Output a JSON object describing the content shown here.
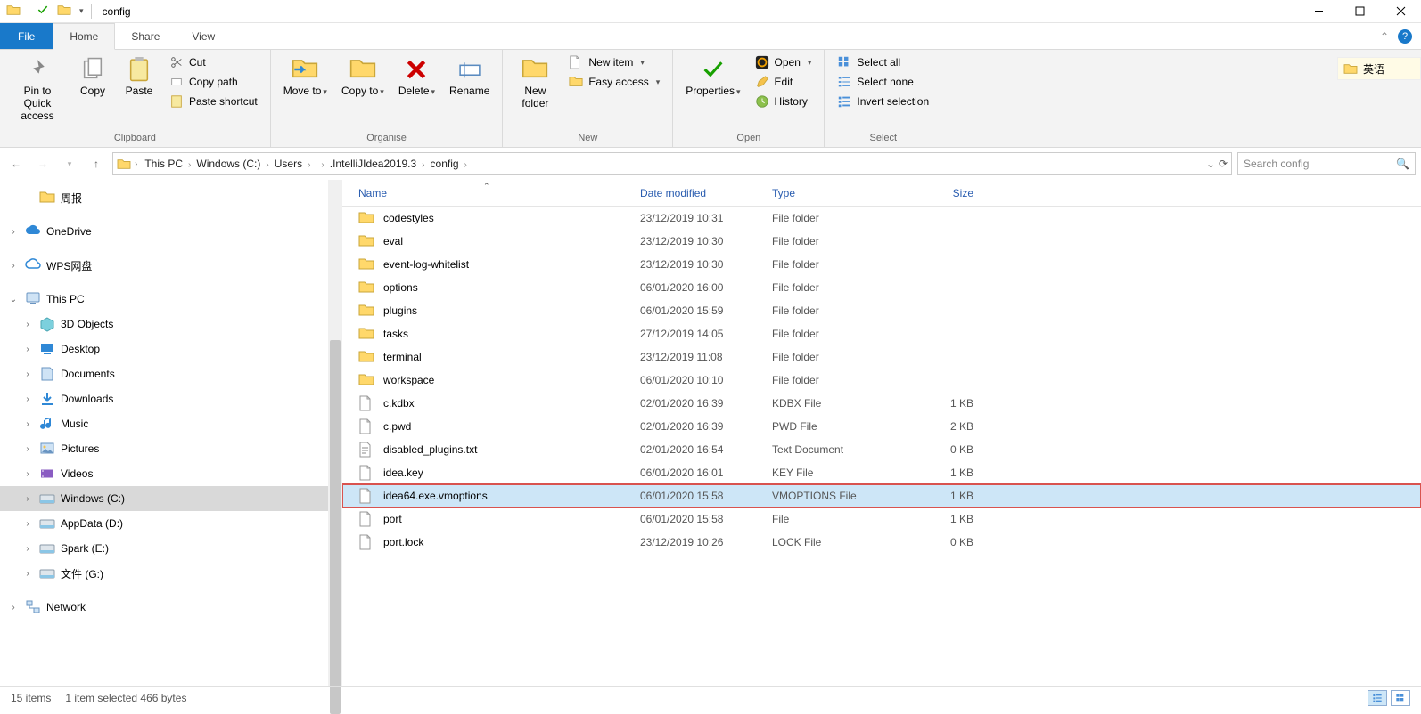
{
  "window": {
    "title": "config"
  },
  "tabs": {
    "file": "File",
    "home": "Home",
    "share": "Share",
    "view": "View"
  },
  "ribbon": {
    "clipboard": {
      "label": "Clipboard",
      "pin": "Pin to Quick access",
      "copy": "Copy",
      "paste": "Paste",
      "cut": "Cut",
      "copy_path": "Copy path",
      "paste_shortcut": "Paste shortcut"
    },
    "organise": {
      "label": "Organise",
      "move_to": "Move to",
      "copy_to": "Copy to",
      "delete": "Delete",
      "rename": "Rename"
    },
    "new": {
      "label": "New",
      "new_folder": "New folder",
      "new_item": "New item",
      "easy_access": "Easy access"
    },
    "open": {
      "label": "Open",
      "properties": "Properties",
      "open": "Open",
      "edit": "Edit",
      "history": "History"
    },
    "select": {
      "label": "Select",
      "select_all": "Select all",
      "select_none": "Select none",
      "invert": "Invert selection"
    }
  },
  "breadcrumb": [
    "This PC",
    "Windows (C:)",
    "Users",
    "",
    ".IntelliJIdea2019.3",
    "config"
  ],
  "search": {
    "placeholder": "Search config"
  },
  "tree": {
    "items": [
      {
        "label": "周报",
        "indent": 1,
        "icon": "folder"
      },
      {
        "label": "OneDrive",
        "indent": 0,
        "icon": "cloud-blue",
        "twisty": ">"
      },
      {
        "label": "WPS网盘",
        "indent": 0,
        "icon": "cloud-outline",
        "twisty": ">"
      },
      {
        "label": "This PC",
        "indent": 0,
        "icon": "pc",
        "twisty": "v"
      },
      {
        "label": "3D Objects",
        "indent": 1,
        "icon": "cube",
        "twisty": ">"
      },
      {
        "label": "Desktop",
        "indent": 1,
        "icon": "desktop",
        "twisty": ">"
      },
      {
        "label": "Documents",
        "indent": 1,
        "icon": "docs",
        "twisty": ">"
      },
      {
        "label": "Downloads",
        "indent": 1,
        "icon": "down",
        "twisty": ">"
      },
      {
        "label": "Music",
        "indent": 1,
        "icon": "music",
        "twisty": ">"
      },
      {
        "label": "Pictures",
        "indent": 1,
        "icon": "pic",
        "twisty": ">"
      },
      {
        "label": "Videos",
        "indent": 1,
        "icon": "vid",
        "twisty": ">"
      },
      {
        "label": "Windows (C:)",
        "indent": 1,
        "icon": "drive",
        "twisty": ">",
        "selected": true
      },
      {
        "label": "AppData (D:)",
        "indent": 1,
        "icon": "drive",
        "twisty": ">"
      },
      {
        "label": "Spark (E:)",
        "indent": 1,
        "icon": "drive",
        "twisty": ">"
      },
      {
        "label": "文件 (G:)",
        "indent": 1,
        "icon": "drive",
        "twisty": ">"
      },
      {
        "label": "Network",
        "indent": 0,
        "icon": "net",
        "twisty": ">"
      }
    ]
  },
  "columns": {
    "name": "Name",
    "date": "Date modified",
    "type": "Type",
    "size": "Size"
  },
  "rows": [
    {
      "name": "codestyles",
      "date": "23/12/2019 10:31",
      "type": "File folder",
      "size": "",
      "icon": "folder"
    },
    {
      "name": "eval",
      "date": "23/12/2019 10:30",
      "type": "File folder",
      "size": "",
      "icon": "folder"
    },
    {
      "name": "event-log-whitelist",
      "date": "23/12/2019 10:30",
      "type": "File folder",
      "size": "",
      "icon": "folder"
    },
    {
      "name": "options",
      "date": "06/01/2020 16:00",
      "type": "File folder",
      "size": "",
      "icon": "folder"
    },
    {
      "name": "plugins",
      "date": "06/01/2020 15:59",
      "type": "File folder",
      "size": "",
      "icon": "folder"
    },
    {
      "name": "tasks",
      "date": "27/12/2019 14:05",
      "type": "File folder",
      "size": "",
      "icon": "folder"
    },
    {
      "name": "terminal",
      "date": "23/12/2019 11:08",
      "type": "File folder",
      "size": "",
      "icon": "folder"
    },
    {
      "name": "workspace",
      "date": "06/01/2020 10:10",
      "type": "File folder",
      "size": "",
      "icon": "folder"
    },
    {
      "name": "c.kdbx",
      "date": "02/01/2020 16:39",
      "type": "KDBX File",
      "size": "1 KB",
      "icon": "file"
    },
    {
      "name": "c.pwd",
      "date": "02/01/2020 16:39",
      "type": "PWD File",
      "size": "2 KB",
      "icon": "file"
    },
    {
      "name": "disabled_plugins.txt",
      "date": "02/01/2020 16:54",
      "type": "Text Document",
      "size": "0 KB",
      "icon": "txt"
    },
    {
      "name": "idea.key",
      "date": "06/01/2020 16:01",
      "type": "KEY File",
      "size": "1 KB",
      "icon": "file"
    },
    {
      "name": "idea64.exe.vmoptions",
      "date": "06/01/2020 15:58",
      "type": "VMOPTIONS File",
      "size": "1 KB",
      "icon": "file",
      "selected": true,
      "boxed": true
    },
    {
      "name": "port",
      "date": "06/01/2020 15:58",
      "type": "File",
      "size": "1 KB",
      "icon": "file"
    },
    {
      "name": "port.lock",
      "date": "23/12/2019 10:26",
      "type": "LOCK File",
      "size": "0 KB",
      "icon": "file"
    }
  ],
  "status": {
    "count": "15 items",
    "selection": "1 item selected  466 bytes"
  },
  "lang": {
    "label": "英语"
  }
}
